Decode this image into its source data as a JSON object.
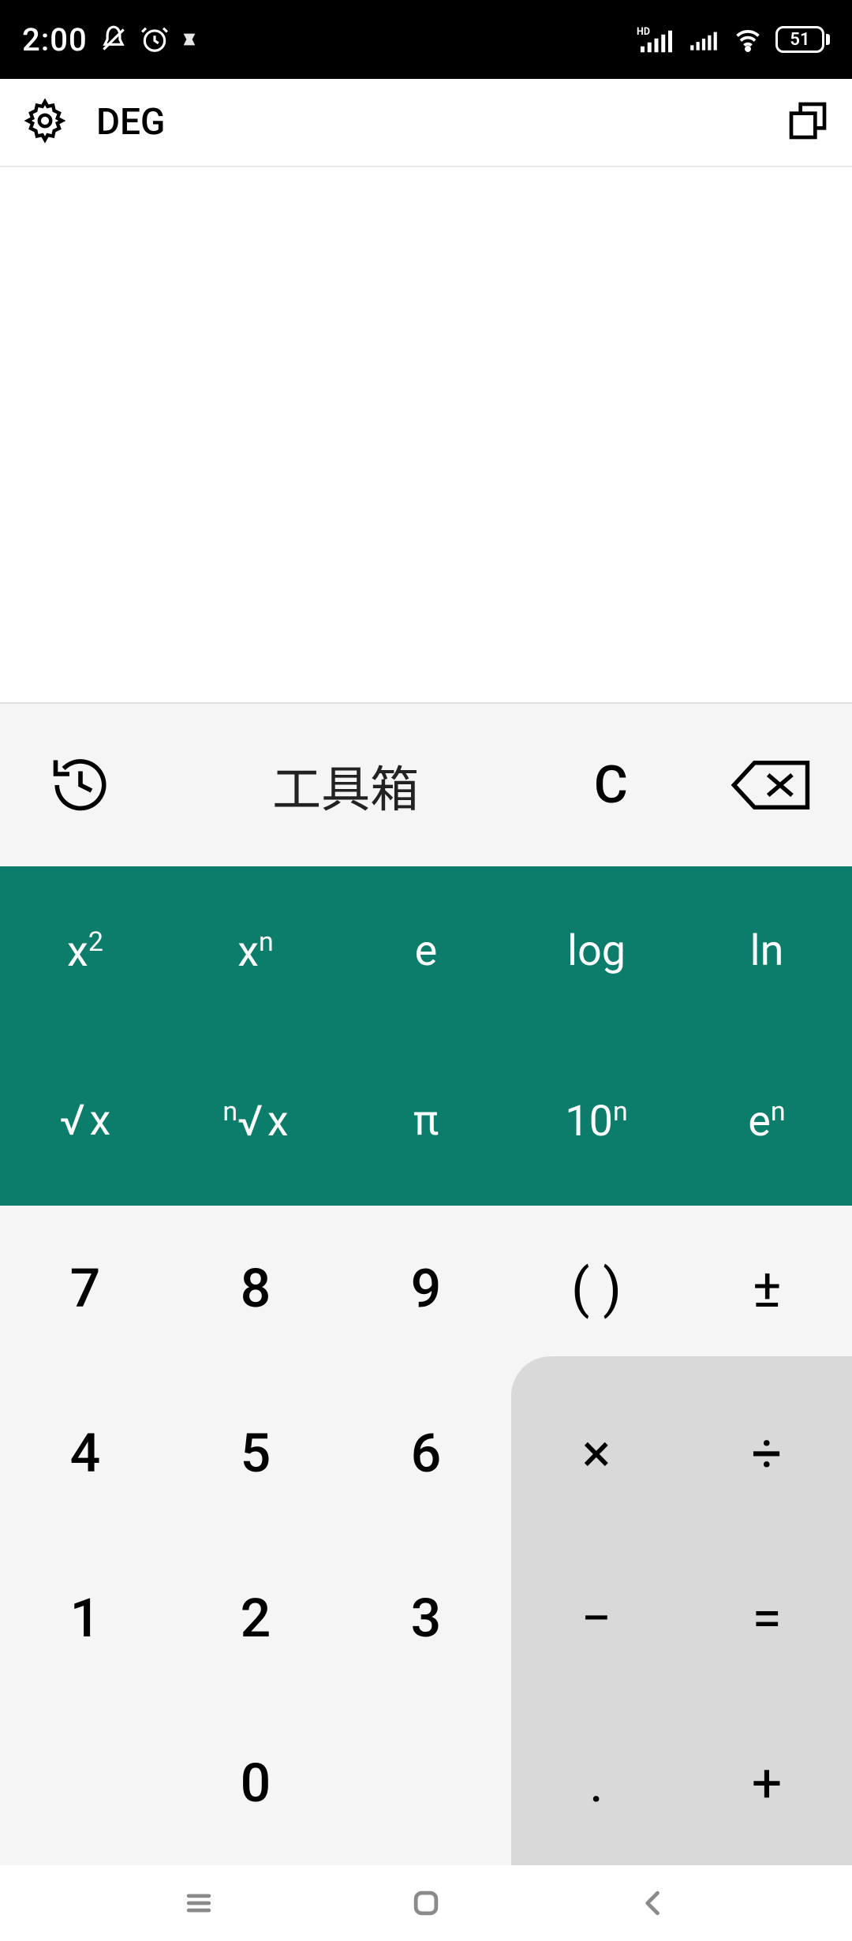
{
  "status": {
    "time": "2:00",
    "battery_pct": "51"
  },
  "header": {
    "mode": "DEG"
  },
  "toolbar": {
    "toolbox_label": "工具箱",
    "clear_label": "C"
  },
  "sci": {
    "r0": [
      "x²",
      "xⁿ",
      "e",
      "log",
      "ln"
    ],
    "r1": [
      "√x",
      "ⁿ√x",
      "π",
      "10ⁿ",
      "eⁿ"
    ]
  },
  "keys": {
    "r0": [
      "7",
      "8",
      "9",
      "( )",
      "±"
    ],
    "r1": [
      "4",
      "5",
      "6",
      "×",
      "÷"
    ],
    "r2": [
      "1",
      "2",
      "3",
      "−",
      "="
    ],
    "r3": [
      "",
      "0",
      "",
      ".",
      "+"
    ]
  }
}
